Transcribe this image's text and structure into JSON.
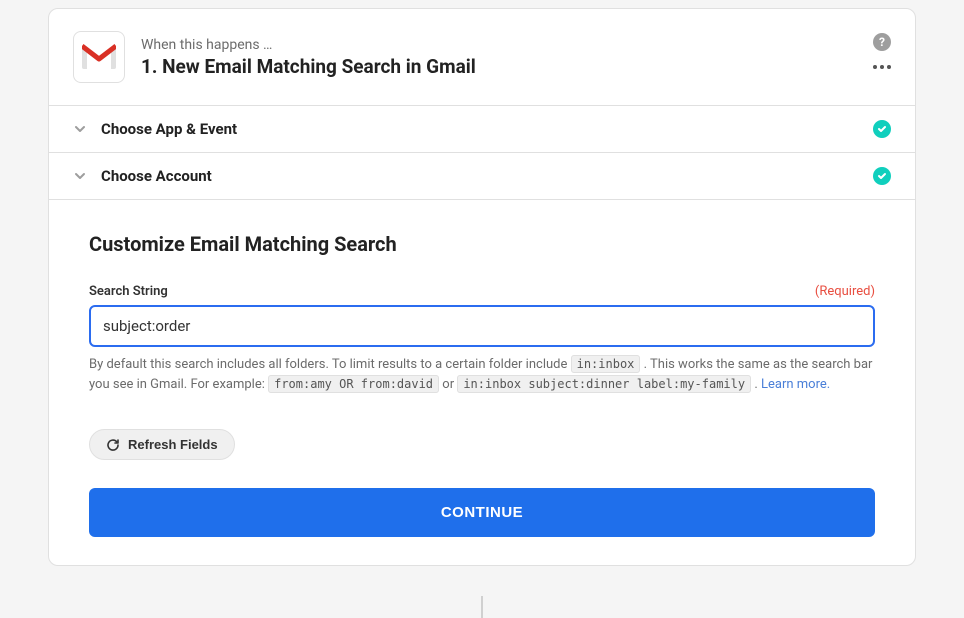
{
  "header": {
    "subtitle": "When this happens …",
    "title": "1. New Email Matching Search in Gmail",
    "app_icon": "gmail-icon"
  },
  "sections": {
    "choose_app_event": {
      "label": "Choose App & Event",
      "completed": true
    },
    "choose_account": {
      "label": "Choose Account",
      "completed": true
    }
  },
  "customize": {
    "heading": "Customize Email Matching Search",
    "field_label": "Search String",
    "required_text": "(Required)",
    "input_value": "subject:order",
    "help_prefix": "By default this search includes all folders. To limit results to a certain folder include ",
    "help_code1": "in:inbox",
    "help_middle1": " . This works the same as the search bar you see in Gmail. For example: ",
    "help_code2": "from:amy OR from:david",
    "help_or": " or ",
    "help_code3": "in:inbox subject:dinner label:my-family",
    "help_suffix": " . ",
    "learn_more": "Learn more."
  },
  "buttons": {
    "refresh": "Refresh Fields",
    "continue": "CONTINUE"
  },
  "colors": {
    "primary": "#1f6feb",
    "success": "#10cfbd",
    "danger": "#e84e40",
    "focus_border": "#2b6cf0"
  }
}
